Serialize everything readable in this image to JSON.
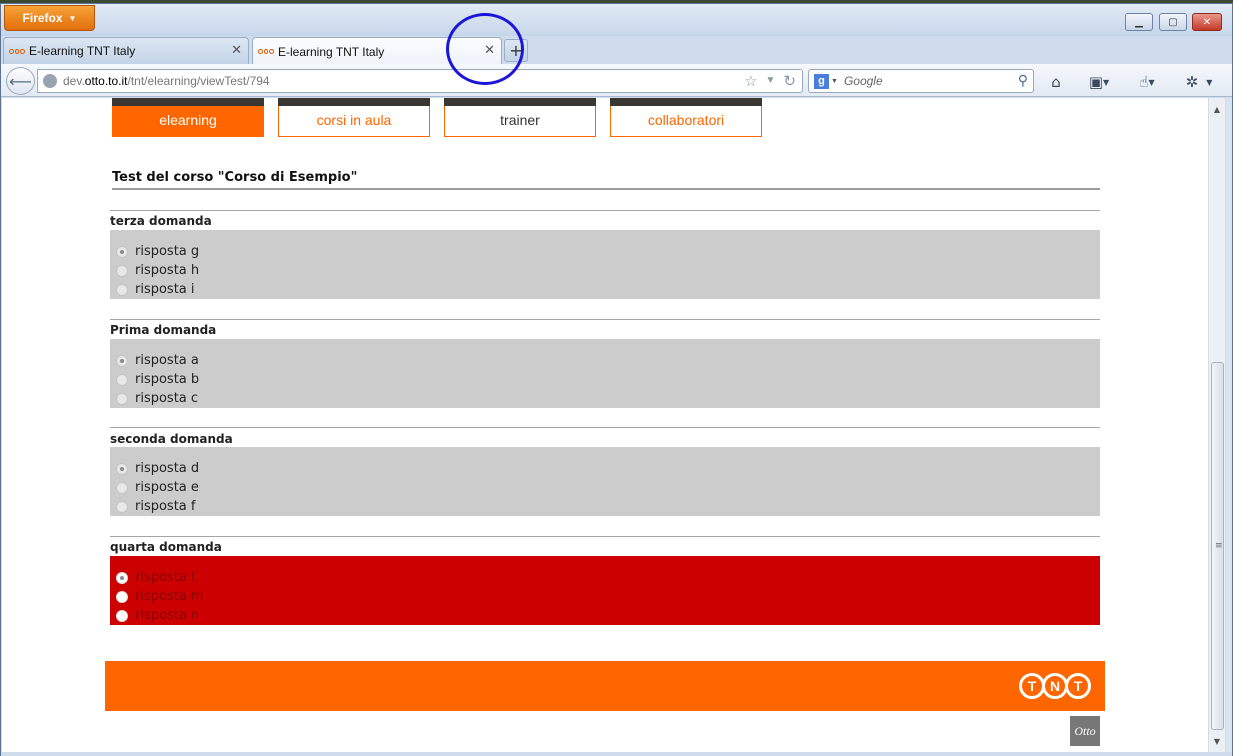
{
  "browser": {
    "menu_label": "Firefox",
    "tabs": [
      {
        "title": "E-learning TNT Italy"
      },
      {
        "title": "E-learning TNT Italy"
      }
    ],
    "url": {
      "prefix": "dev.",
      "host": "otto.to.it",
      "path": "/tnt/elearning/viewTest/794"
    },
    "search": {
      "engine_icon": "google-icon",
      "placeholder": "Google"
    }
  },
  "site": {
    "nav": [
      {
        "label": "elearning"
      },
      {
        "label": "corsi in aula"
      },
      {
        "label": "trainer"
      },
      {
        "label": "collaboratori"
      }
    ],
    "page_title": "Test del corso \"Corso di Esempio\"",
    "questions": [
      {
        "title": "terza domanda",
        "state": "neutral",
        "options": [
          "risposta g",
          "risposta h",
          "risposta i"
        ],
        "selected": 0
      },
      {
        "title": "Prima domanda",
        "state": "neutral",
        "options": [
          "risposta a",
          "risposta b",
          "risposta c"
        ],
        "selected": 0
      },
      {
        "title": "seconda domanda",
        "state": "neutral",
        "options": [
          "risposta d",
          "risposta e",
          "risposta f"
        ],
        "selected": 0
      },
      {
        "title": "quarta domanda",
        "state": "wrong",
        "options": [
          "risposta l",
          "risposta m",
          "risposta n"
        ],
        "selected": 0
      }
    ],
    "footer_logo": "TNT",
    "otto_logo": "Otto",
    "colors": {
      "brand": "#ff6600",
      "wrong": "#cc0000",
      "option_bg": "#cccccc"
    }
  }
}
